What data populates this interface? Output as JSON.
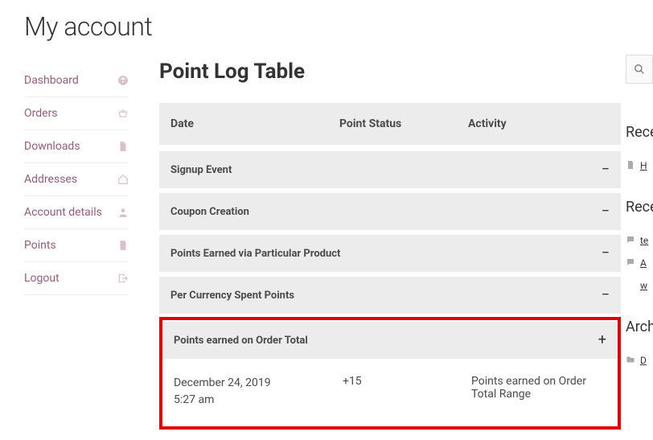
{
  "page_title": "My account",
  "sidebar": {
    "items": [
      {
        "label": "Dashboard",
        "icon": "dashboard-icon"
      },
      {
        "label": "Orders",
        "icon": "basket-icon"
      },
      {
        "label": "Downloads",
        "icon": "file-icon"
      },
      {
        "label": "Addresses",
        "icon": "home-icon"
      },
      {
        "label": "Account details",
        "icon": "user-icon"
      },
      {
        "label": "Points",
        "icon": "file-icon"
      },
      {
        "label": "Logout",
        "icon": "signout-icon"
      }
    ]
  },
  "main": {
    "title": "Point Log Table",
    "columns": {
      "date": "Date",
      "status": "Point Status",
      "activity": "Activity"
    },
    "sections": [
      {
        "title": "Signup Event",
        "expanded": false,
        "toggle": "−"
      },
      {
        "title": "Coupon Creation",
        "expanded": false,
        "toggle": "−"
      },
      {
        "title": "Points Earned via Particular Product",
        "expanded": false,
        "toggle": "−"
      },
      {
        "title": "Per Currency Spent Points",
        "expanded": false,
        "toggle": "−"
      },
      {
        "title": "Points earned on Order Total",
        "expanded": true,
        "toggle": "+"
      }
    ],
    "detail": {
      "date_line1": "December 24, 2019",
      "date_line2": "5:27 am",
      "status": "+15",
      "activity": "Points earned on Order Total Range"
    }
  },
  "right_rail": {
    "sections": [
      {
        "heading": "Rece",
        "items": [
          {
            "icon": "page-icon",
            "text": "H"
          }
        ]
      },
      {
        "heading": "Rece",
        "items": [
          {
            "icon": "comment-icon",
            "text": "te"
          },
          {
            "icon": "comment-icon",
            "text": "A"
          },
          {
            "icon": "",
            "text": "w"
          }
        ]
      },
      {
        "heading": "Arch",
        "items": [
          {
            "icon": "folder-icon",
            "text": "D"
          }
        ]
      }
    ]
  }
}
